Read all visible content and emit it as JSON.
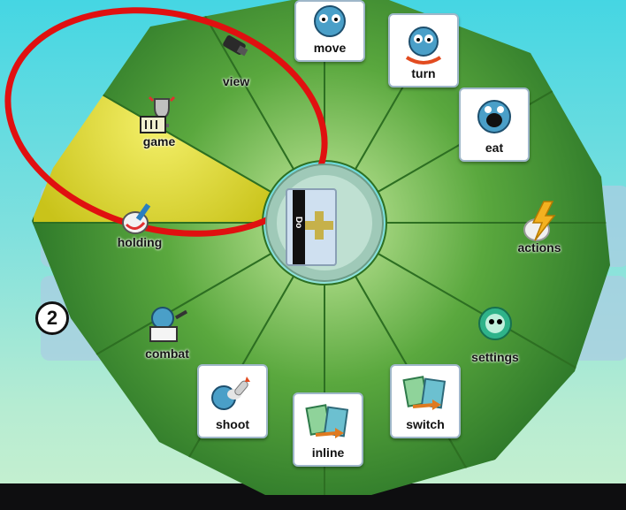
{
  "wheel": {
    "items": [
      {
        "id": "view",
        "label": "view"
      },
      {
        "id": "move",
        "label": "move"
      },
      {
        "id": "turn",
        "label": "turn"
      },
      {
        "id": "eat",
        "label": "eat"
      },
      {
        "id": "actions",
        "label": "actions"
      },
      {
        "id": "settings",
        "label": "settings"
      },
      {
        "id": "switch",
        "label": "switch"
      },
      {
        "id": "inline",
        "label": "inline"
      },
      {
        "id": "shoot",
        "label": "shoot"
      },
      {
        "id": "combat",
        "label": "combat"
      },
      {
        "id": "holding",
        "label": "holding"
      },
      {
        "id": "game",
        "label": "game",
        "selected": true
      }
    ],
    "center_label": "Do"
  },
  "page_badge": "2",
  "colors": {
    "wedge": "#4f9f3a",
    "wedge_dark": "#2f7a2a",
    "selected_wedge": "#e3df22",
    "highlight_ring": "#e01010",
    "background_top": "#45d6e3",
    "background_bottom": "#c8f0cf"
  }
}
